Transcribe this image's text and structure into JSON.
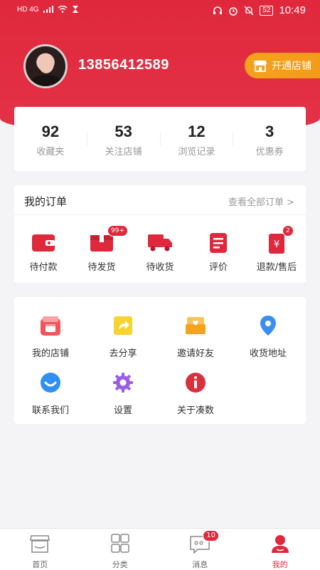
{
  "status_bar": {
    "network": "HD 4G",
    "battery": "52",
    "time": "10:49"
  },
  "profile": {
    "phone": "13856412589",
    "open_shop_label": "开通店铺"
  },
  "stats": [
    {
      "value": "92",
      "label": "收藏夹"
    },
    {
      "value": "53",
      "label": "关注店铺"
    },
    {
      "value": "12",
      "label": "浏览记录"
    },
    {
      "value": "3",
      "label": "优惠券"
    }
  ],
  "orders": {
    "title": "我的订单",
    "view_all": "查看全部订单 >",
    "items": [
      {
        "label": "待付款",
        "icon": "wallet-icon"
      },
      {
        "label": "待发货",
        "icon": "package-icon",
        "badge": "99+"
      },
      {
        "label": "待收货",
        "icon": "truck-icon"
      },
      {
        "label": "评价",
        "icon": "review-icon"
      },
      {
        "label": "退款/售后",
        "icon": "refund-icon",
        "badge": "2"
      }
    ]
  },
  "tools": [
    {
      "label": "我的店铺",
      "icon": "shop-icon"
    },
    {
      "label": "去分享",
      "icon": "share-icon"
    },
    {
      "label": "邀请好友",
      "icon": "invite-icon"
    },
    {
      "label": "收货地址",
      "icon": "location-icon"
    },
    {
      "label": "联系我们",
      "icon": "contact-icon"
    },
    {
      "label": "设置",
      "icon": "settings-icon"
    },
    {
      "label": "关于凑数",
      "icon": "info-icon"
    }
  ],
  "tabbar": [
    {
      "label": "首页",
      "icon": "home-icon"
    },
    {
      "label": "分类",
      "icon": "category-icon"
    },
    {
      "label": "消息",
      "icon": "message-icon",
      "badge": "10"
    },
    {
      "label": "我的",
      "icon": "profile-icon",
      "active": true
    }
  ],
  "colors": {
    "accent": "#e0283c",
    "orange": "#f6a21d"
  }
}
